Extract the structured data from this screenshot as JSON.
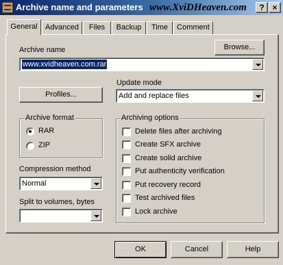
{
  "window": {
    "title": "Archive name and parameters",
    "watermark": "www.XviDHeaven.com",
    "help_button": "?",
    "close_button": "×"
  },
  "tabs": [
    {
      "label": "General",
      "active": true
    },
    {
      "label": "Advanced",
      "active": false
    },
    {
      "label": "Files",
      "active": false
    },
    {
      "label": "Backup",
      "active": false
    },
    {
      "label": "Time",
      "active": false
    },
    {
      "label": "Comment",
      "active": false
    }
  ],
  "archive_name": {
    "label": "Archive name",
    "browse_label": "Browse...",
    "value": "www.xvidheaven.com.rar"
  },
  "profiles_label": "Profiles...",
  "update_mode": {
    "label": "Update mode",
    "value": "Add and replace files"
  },
  "archive_format": {
    "label": "Archive format",
    "options": [
      {
        "label": "RAR",
        "checked": true
      },
      {
        "label": "ZIP",
        "checked": false
      }
    ]
  },
  "compression": {
    "label": "Compression method",
    "value": "Normal"
  },
  "split": {
    "label": "Split to volumes, bytes",
    "value": ""
  },
  "archiving_options": {
    "label": "Archiving options",
    "items": [
      {
        "label": "Delete files after archiving",
        "checked": false
      },
      {
        "label": "Create SFX archive",
        "checked": false
      },
      {
        "label": "Create solid archive",
        "checked": false
      },
      {
        "label": "Put authenticity verification",
        "checked": false
      },
      {
        "label": "Put recovery record",
        "checked": false
      },
      {
        "label": "Test archived files",
        "checked": false
      },
      {
        "label": "Lock archive",
        "checked": false
      }
    ]
  },
  "footer": {
    "ok_label": "OK",
    "cancel_label": "Cancel",
    "help_label": "Help"
  }
}
